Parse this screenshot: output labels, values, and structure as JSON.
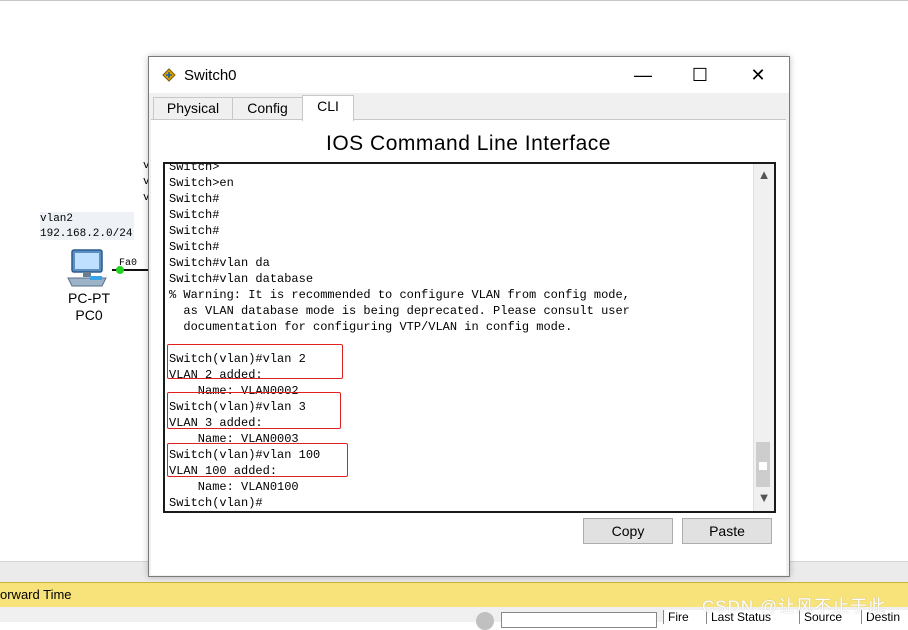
{
  "workspace": {
    "subnet_label": "vlan2",
    "subnet_addr": "192.168.2.0/24",
    "pc_type": "PC-PT",
    "pc_name": "PC0",
    "port_label": "Fa0",
    "hidden_text": "v\nv\nv"
  },
  "window": {
    "title": "Switch0",
    "minimize_glyph": "—",
    "maximize_glyph": "☐",
    "close_glyph": "✕",
    "tabs": [
      "Physical",
      "Config",
      "CLI"
    ],
    "active_tab": "CLI",
    "heading": "IOS Command Line Interface",
    "terminal_lines": [
      "Switch>",
      "Switch>en",
      "Switch#",
      "Switch#",
      "Switch#",
      "Switch#",
      "Switch#vlan da",
      "Switch#vlan database",
      "% Warning: It is recommended to configure VLAN from config mode,",
      "  as VLAN database mode is being deprecated. Please consult user",
      "  documentation for configuring VTP/VLAN in config mode.",
      "",
      "Switch(vlan)#vlan 2",
      "VLAN 2 added:",
      "    Name: VLAN0002",
      "Switch(vlan)#vlan 3",
      "VLAN 3 added:",
      "    Name: VLAN0003",
      "Switch(vlan)#vlan 100",
      "VLAN 100 added:",
      "    Name: VLAN0100",
      "Switch(vlan)#"
    ],
    "scroll_up": "▲",
    "scroll_down": "▼",
    "copy_label": "Copy",
    "paste_label": "Paste"
  },
  "bottom_panel": {
    "header_text": "orward Time",
    "columns": [
      "Fire",
      "Last Status",
      "Source",
      "Destin"
    ]
  },
  "watermark": "CSDN @让风不止于此"
}
